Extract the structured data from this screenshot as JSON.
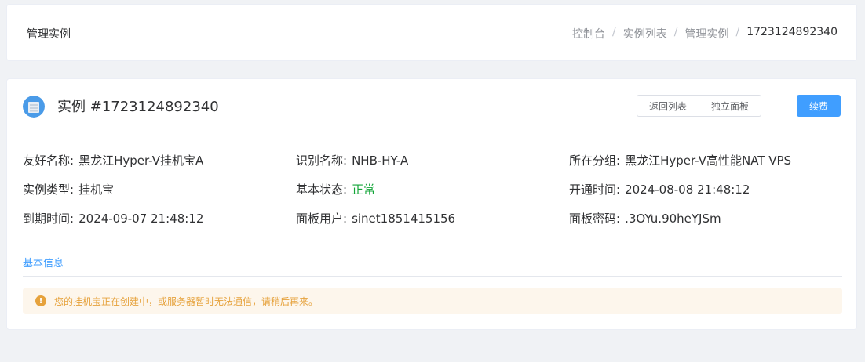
{
  "header": {
    "title": "管理实例",
    "breadcrumb": [
      "控制台",
      "实例列表",
      "管理实例",
      "1723124892340"
    ],
    "separator": "/"
  },
  "instance": {
    "title": "实例 #1723124892340",
    "buttons": {
      "back_to_list": "返回列表",
      "standalone_panel": "独立面板",
      "renew": "续费"
    },
    "fields": [
      [
        {
          "label": "友好名称:",
          "value": "黑龙江Hyper-V挂机宝A"
        },
        {
          "label": "识别名称:",
          "value": "NHB-HY-A"
        },
        {
          "label": "所在分组:",
          "value": "黑龙江Hyper-V高性能NAT VPS"
        }
      ],
      [
        {
          "label": "实例类型:",
          "value": "挂机宝"
        },
        {
          "label": "基本状态:",
          "value": "正常"
        },
        {
          "label": "开通时间:",
          "value": "2024-08-08 21:48:12"
        }
      ],
      [
        {
          "label": "到期时间:",
          "value": "2024-09-07 21:48:12"
        },
        {
          "label": "面板用户:",
          "value": "sinet1851415156"
        },
        {
          "label": "面板密码:",
          "value": ".3OYu.90heYJSm"
        }
      ]
    ]
  },
  "tabs": {
    "active": "基本信息"
  },
  "alert": {
    "icon": "warning-icon",
    "text": "您的挂机宝正在创建中，或服务器暂时无法通信，请稍后再来。"
  },
  "colors": {
    "primary": "#409eff",
    "success": "#13a538",
    "warning": "#e6a23c",
    "warning_bg": "#fdf6ec"
  }
}
